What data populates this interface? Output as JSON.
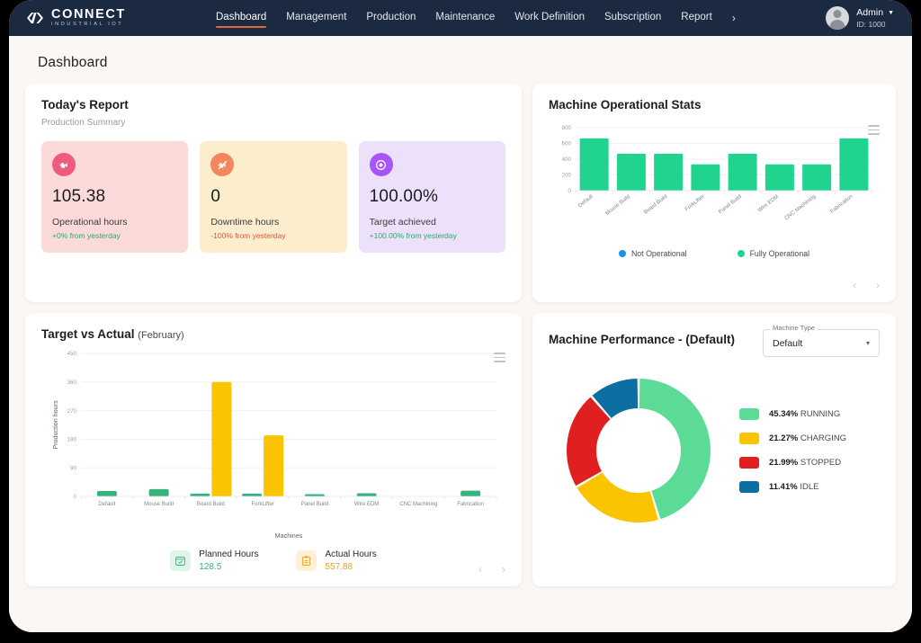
{
  "brand": {
    "name": "CONNECT",
    "tagline": "INDUSTRIAL IOT",
    "accent": "#e2683c"
  },
  "nav": {
    "items": [
      {
        "label": "Dashboard",
        "active": true
      },
      {
        "label": "Management",
        "active": false
      },
      {
        "label": "Production",
        "active": false
      },
      {
        "label": "Maintenance",
        "active": false
      },
      {
        "label": "Work Definition",
        "active": false
      },
      {
        "label": "Subscription",
        "active": false
      },
      {
        "label": "Report",
        "active": false
      }
    ],
    "more": "›"
  },
  "user": {
    "name": "Admin",
    "id": "ID: 1000",
    "caret": "▼"
  },
  "page": {
    "title": "Dashboard"
  },
  "todays_report": {
    "title": "Today's Report",
    "subtitle": "Production Summary",
    "tiles": [
      {
        "value": "105.38",
        "label": "Operational hours",
        "delta": "+0% from yesterday",
        "delta_dir": "up",
        "theme": "pink",
        "icon": "engine-icon"
      },
      {
        "value": "0",
        "label": "Downtime hours",
        "delta": "-100% from yesterday",
        "delta_dir": "down",
        "theme": "cream",
        "icon": "engine-off-icon"
      },
      {
        "value": "100.00%",
        "label": "Target achieved",
        "delta": "+100.00% from yesterday",
        "delta_dir": "up",
        "theme": "purple",
        "icon": "target-icon"
      }
    ]
  },
  "machine_stats": {
    "title": "Machine Operational Stats",
    "menu_icon": "hamburger-menu-icon",
    "legend": [
      {
        "label": "Not Operational",
        "color": "#1e90e8"
      },
      {
        "label": "Fully Operational",
        "color": "#20d48f"
      }
    ],
    "pager": {
      "prev": "‹",
      "next": "›"
    }
  },
  "target_vs_actual": {
    "title": "Target vs Actual",
    "period": "(February)",
    "menu_icon": "hamburger-menu-icon",
    "footer": [
      {
        "name": "Planned Hours",
        "value": "128.5",
        "theme": "green",
        "icon": "calendar-check-icon"
      },
      {
        "name": "Actual Hours",
        "value": "557.88",
        "theme": "amber",
        "icon": "clipboard-icon"
      }
    ],
    "pager": {
      "prev": "‹",
      "next": "›"
    }
  },
  "machine_performance": {
    "title": "Machine Performance - (Default)",
    "select": {
      "legend": "Machine Type",
      "value": "Default",
      "caret": "▾"
    }
  },
  "chart_data": [
    {
      "id": "machine-operational-stats",
      "type": "bar",
      "title": "Machine Operational Stats",
      "categories": [
        "Default",
        "Mouse Build",
        "Board Build",
        "ForkLifter",
        "Panel Build",
        "Wire EDM",
        "CNC Machining",
        "Fabrication"
      ],
      "series": [
        {
          "name": "Fully Operational",
          "color": "#20d48f",
          "values": [
            665,
            468,
            468,
            335,
            468,
            335,
            335,
            665
          ]
        },
        {
          "name": "Not Operational",
          "color": "#1e90e8",
          "values": [
            0,
            0,
            0,
            0,
            0,
            0,
            0,
            0
          ]
        }
      ],
      "yticks": [
        0,
        200,
        400,
        600,
        800
      ],
      "ylim": [
        0,
        800
      ],
      "xlabel": "",
      "ylabel": "",
      "grid": true,
      "legend_position": "bottom"
    },
    {
      "id": "target-vs-actual",
      "type": "bar",
      "title": "Target vs Actual (February)",
      "categories": [
        "Default",
        "Mouse Build",
        "Board Build",
        "ForkLifter",
        "Panel Build",
        "Wire EDM",
        "CNC Machining",
        "Fabrication"
      ],
      "series": [
        {
          "name": "Planned Hours",
          "color": "#35b37e",
          "values": [
            17,
            23,
            9,
            9,
            3,
            10,
            0,
            18
          ]
        },
        {
          "name": "Actual Hours",
          "color": "#fbc400",
          "values": [
            0,
            0,
            360,
            192,
            0,
            0,
            0,
            0
          ]
        }
      ],
      "yticks": [
        0,
        90,
        180,
        270,
        360,
        450
      ],
      "ylim": [
        0,
        450
      ],
      "xlabel": "Machines",
      "ylabel": "Production hours",
      "grid": true,
      "legend_position": "bottom"
    },
    {
      "id": "machine-performance-donut",
      "type": "pie",
      "title": "Machine Performance - (Default)",
      "labels": [
        "RUNNING",
        "CHARGING",
        "STOPPED",
        "IDLE"
      ],
      "values": [
        45.34,
        21.27,
        21.99,
        11.41
      ],
      "value_labels": [
        "45.34%",
        "21.27%",
        "21.99%",
        "11.41%"
      ],
      "colors": [
        "#5bdb95",
        "#fbc400",
        "#e02020",
        "#0d6ea1"
      ],
      "legend_position": "right",
      "donut": true
    }
  ]
}
